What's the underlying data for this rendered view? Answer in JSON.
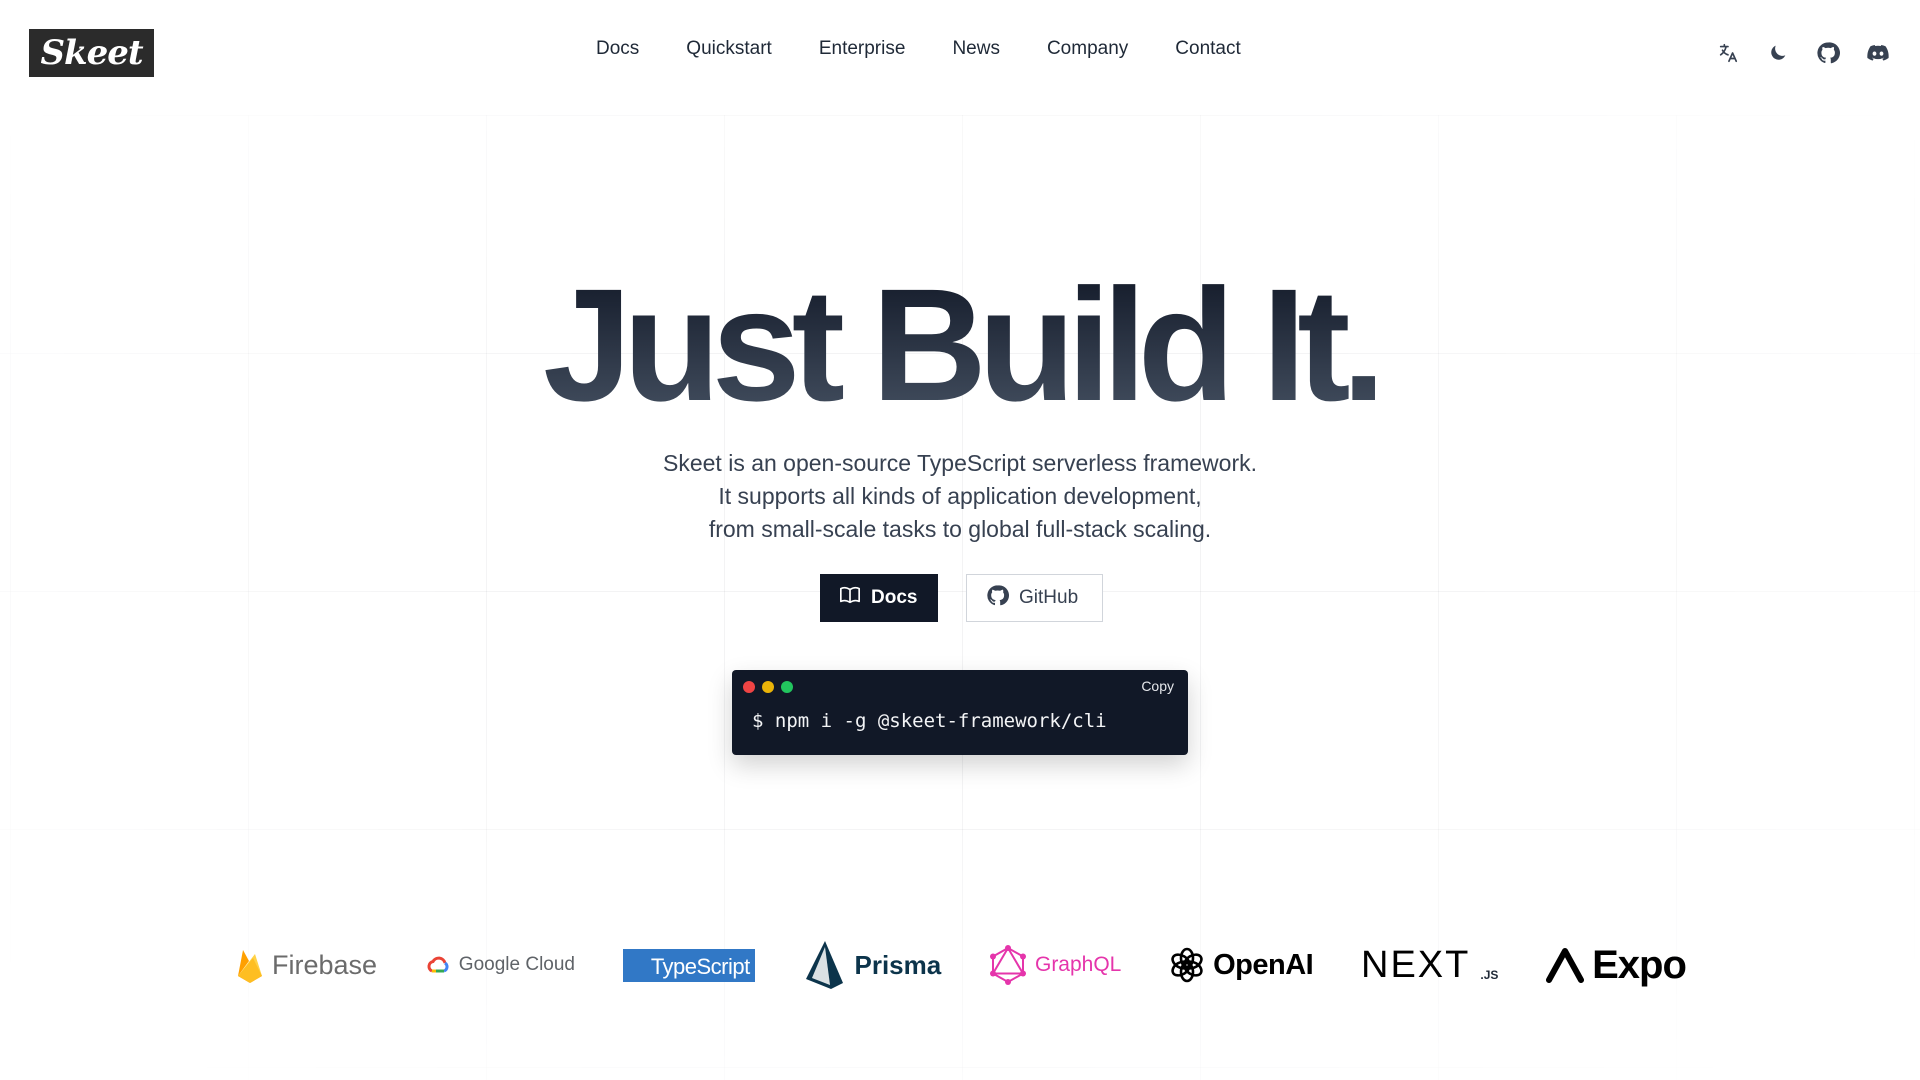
{
  "header": {
    "logo_text": "Skeet",
    "nav": [
      {
        "label": "Docs"
      },
      {
        "label": "Quickstart"
      },
      {
        "label": "Enterprise"
      },
      {
        "label": "News"
      },
      {
        "label": "Company"
      },
      {
        "label": "Contact"
      }
    ],
    "icons": [
      "translate-icon",
      "moon-icon",
      "github-icon",
      "discord-icon"
    ]
  },
  "hero": {
    "title": "Just Build It.",
    "description": [
      "Skeet is an open-source TypeScript serverless framework.",
      "It supports all kinds of application development,",
      "from small-scale tasks to global full-stack scaling."
    ],
    "buttons": {
      "docs": "Docs",
      "github": "GitHub"
    }
  },
  "terminal": {
    "copy_label": "Copy",
    "command": "$ npm i -g @skeet-framework/cli",
    "dot_colors": [
      "#ef4444",
      "#eab308",
      "#22c55e"
    ]
  },
  "logos": {
    "firebase": "Firebase",
    "gcloud": "Google Cloud",
    "typescript": "TypeScript",
    "prisma": "Prisma",
    "graphql": "GraphQL",
    "openai": "OpenAI",
    "next": "NEXT",
    "next_sub": ".JS",
    "expo": "Expo"
  },
  "colors": {
    "primary_button": "#111827",
    "typescript": "#3178c6",
    "graphql": "#e535ab",
    "prisma": "#0c344b"
  }
}
